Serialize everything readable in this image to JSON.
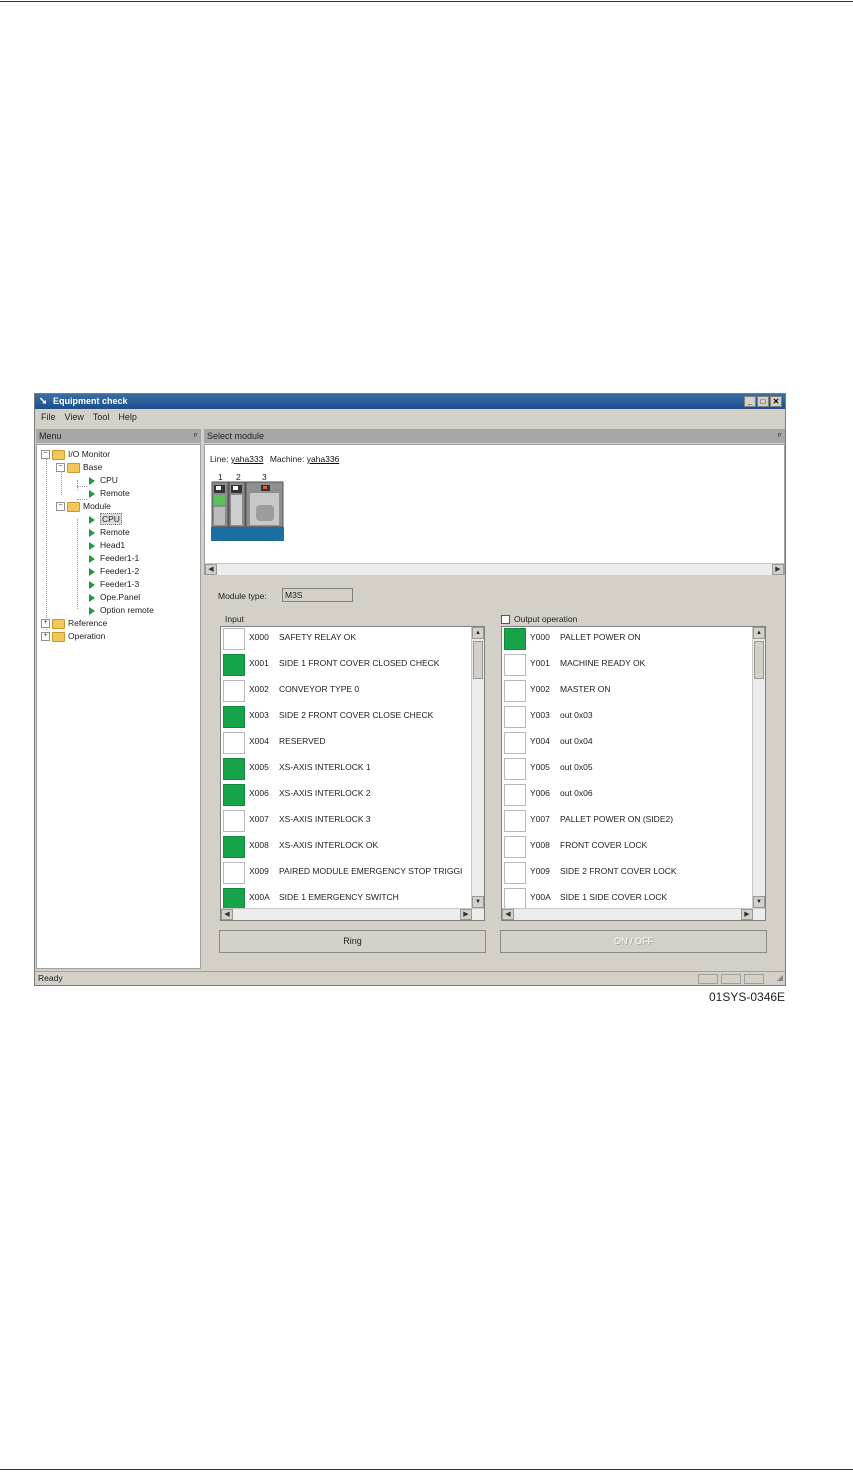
{
  "window": {
    "title": "Equipment check",
    "menu": [
      "File",
      "View",
      "Tool",
      "Help"
    ],
    "controls": [
      "minimize-icon",
      "maximize-icon",
      "close-icon"
    ]
  },
  "left_panel": {
    "header": "Menu",
    "tree": {
      "io_monitor": "I/O Monitor",
      "base": "Base",
      "base_cpu": "CPU",
      "base_remote": "Remote",
      "module": "Module",
      "module_cpu": "CPU",
      "module_remote": "Remote",
      "head1": "Head1",
      "feeder1": "Feeder1-1",
      "feeder2": "Feeder1-2",
      "feeder3": "Feeder1-3",
      "ope_panel": "Ope.Panel",
      "option_remote": "Option remote",
      "reference": "Reference",
      "operation": "Operation"
    }
  },
  "right_panel": {
    "header": "Select module",
    "line_label": "Line:",
    "line_value": "yaha333",
    "machine_label": "Machine:",
    "machine_value": "yaha336",
    "module_numbers": [
      "1",
      "2",
      "3"
    ],
    "module_type_label": "Module type:",
    "module_type_value": "M3S",
    "input_label": "Input",
    "output_label": "Output operation",
    "ring_button": "Ring",
    "onoff_button": "ON / OFF"
  },
  "inputs": [
    {
      "code": "X000",
      "desc": "SAFETY RELAY OK",
      "on": false
    },
    {
      "code": "X001",
      "desc": "SIDE 1 FRONT COVER CLOSED CHECK",
      "on": true
    },
    {
      "code": "X002",
      "desc": "CONVEYOR TYPE 0",
      "on": false
    },
    {
      "code": "X003",
      "desc": "SIDE 2 FRONT COVER CLOSE CHECK",
      "on": true
    },
    {
      "code": "X004",
      "desc": "RESERVED",
      "on": false
    },
    {
      "code": "X005",
      "desc": "XS-AXIS INTERLOCK 1",
      "on": true
    },
    {
      "code": "X006",
      "desc": "XS-AXIS INTERLOCK 2",
      "on": true
    },
    {
      "code": "X007",
      "desc": "XS-AXIS INTERLOCK 3",
      "on": false
    },
    {
      "code": "X008",
      "desc": "XS-AXIS INTERLOCK OK",
      "on": true
    },
    {
      "code": "X009",
      "desc": "PAIRED MODULE EMERGENCY STOP TRIGGI",
      "on": false
    },
    {
      "code": "X00A",
      "desc": "SIDE 1 EMERGENCY SWITCH",
      "on": true
    }
  ],
  "outputs": [
    {
      "code": "Y000",
      "desc": "PALLET POWER ON",
      "on": true
    },
    {
      "code": "Y001",
      "desc": "MACHINE READY OK",
      "on": false
    },
    {
      "code": "Y002",
      "desc": "MASTER ON",
      "on": false
    },
    {
      "code": "Y003",
      "desc": "out 0x03",
      "on": false
    },
    {
      "code": "Y004",
      "desc": "out 0x04",
      "on": false
    },
    {
      "code": "Y005",
      "desc": "out 0x05",
      "on": false
    },
    {
      "code": "Y006",
      "desc": "out 0x06",
      "on": false
    },
    {
      "code": "Y007",
      "desc": "PALLET POWER ON (SIDE2)",
      "on": false
    },
    {
      "code": "Y008",
      "desc": "FRONT COVER LOCK",
      "on": false
    },
    {
      "code": "Y009",
      "desc": "SIDE 2 FRONT COVER LOCK",
      "on": false
    },
    {
      "code": "Y00A",
      "desc": "SIDE 1 SIDE COVER LOCK",
      "on": false
    }
  ],
  "status": "Ready",
  "caption": "01SYS-0346E",
  "colors": {
    "on": "#16a34a",
    "title": "#1c4f8a"
  }
}
